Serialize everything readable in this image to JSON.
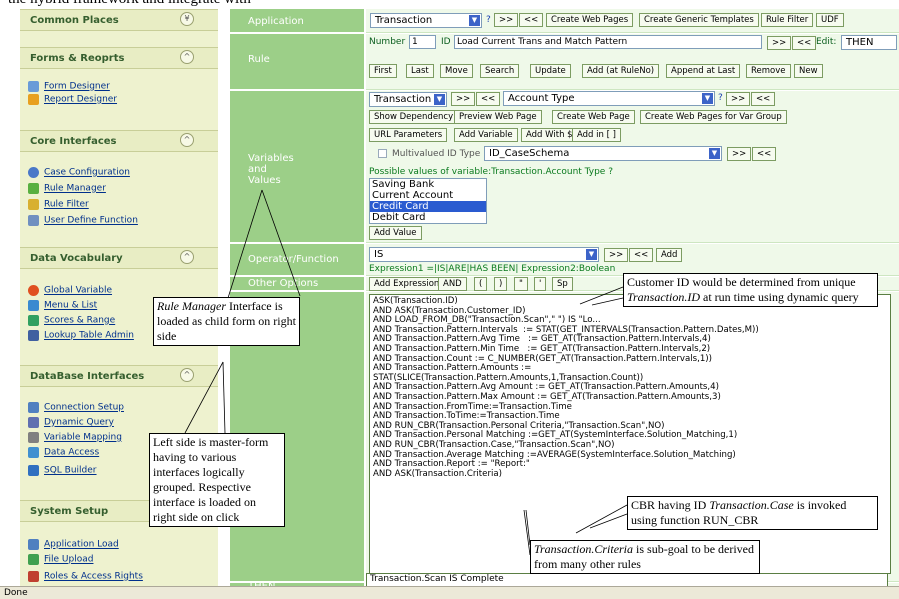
{
  "page_caption": "the hybrid framework and integrate with",
  "sidebar": {
    "sections": [
      {
        "title": "Common Places",
        "links": []
      },
      {
        "title": "Forms & Reoprts",
        "links": [
          "Form Designer",
          "Report Designer"
        ]
      },
      {
        "title": "Core Interfaces",
        "links": [
          "Case Configuration",
          "Rule Manager",
          "Rule Filter",
          "User Define Function"
        ]
      },
      {
        "title": "Data Vocabulary",
        "links": [
          "Global Variable",
          "Menu & List",
          "Scores & Range",
          "Lookup Table Admin"
        ]
      },
      {
        "title": "DataBase Interfaces",
        "links": [
          "Connection Setup",
          "Dynamic Query",
          "Variable Mapping",
          "Data Access",
          "SQL Builder"
        ]
      },
      {
        "title": "System Setup",
        "links": [
          "Application Load",
          "File Upload",
          "Roles & Access Rights"
        ]
      }
    ]
  },
  "labels": {
    "application": "Application",
    "rule": "Rule",
    "variables": "Variables\nand\nValues",
    "operator": "Operator/Function",
    "other": "Other Options",
    "if": "IF",
    "then": "THEN"
  },
  "application": {
    "select": "Transaction",
    "q": "?",
    "next": ">>",
    "prev": "<<",
    "buttons": [
      "Create Web Pages",
      "Create Generic Templates",
      "Rule Filter",
      "UDF"
    ]
  },
  "rule": {
    "number_label": "Number",
    "number": "1",
    "id_label": "ID",
    "id": "Load Current Trans and Match Pattern",
    "next": ">>",
    "prev": "<<",
    "edit_label": "Edit:",
    "edit_value": "THEN",
    "buttons": [
      "First",
      "Last",
      "Move",
      "Search",
      "Update",
      "Add (at RuleNo)",
      "Append at Last",
      "Remove",
      "New"
    ]
  },
  "variables": {
    "select1": "Transaction",
    "next": ">>",
    "prev": "<<",
    "select2": "Account Type",
    "q": "?",
    "row2": [
      "Show Dependency",
      "Preview Web Page",
      "Create Web Page",
      "Create Web Pages for Var Group"
    ],
    "row3": [
      "URL Parameters",
      "Add Variable",
      "Add With $",
      "Add in [ ]"
    ],
    "multivalued_label": "Multivalued ID Type",
    "multivalued_select": "ID_CaseSchema",
    "possible_values": "Possible values of variable:Transaction.Account Type ?",
    "list": [
      "Saving Bank",
      "Current Account",
      "Credit Card",
      "Debit Card"
    ],
    "selected": "Credit Card",
    "add_value": "Add Value"
  },
  "operator": {
    "select": "IS",
    "next": ">>",
    "prev": "<<",
    "add": "Add",
    "expression": "Expression1 =|IS|ARE|HAS BEEN| Expression2:Boolean"
  },
  "other": {
    "buttons": [
      "Add Expression",
      "AND",
      "(",
      ")",
      "\"",
      "'",
      "Sp"
    ]
  },
  "if_code": "ASK(Transaction.ID)\nAND ASK(Transaction.Customer_ID)\nAND LOAD_FROM_DB(\"Transaction.Scan\",\" \") IS \"Lo...\nAND Transaction.Pattern.Intervals  := STAT(GET_INTERVALS(Transaction.Pattern.Dates,M))\nAND Transaction.Pattern.Avg Time   := GET_AT(Transaction.Pattern.Intervals,4)\nAND Transaction.Pattern.Min Time   := GET_AT(Transaction.Pattern.Intervals,2)\nAND Transaction.Count := C_NUMBER(GET_AT(Transaction.Pattern.Intervals,1))\nAND Transaction.Pattern.Amounts :=\nSTAT(SLICE(Transaction.Pattern.Amounts,1,Transaction.Count))\nAND Transaction.Pattern.Avg Amount := GET_AT(Transaction.Pattern.Amounts,4)\nAND Transaction.Pattern.Max Amount := GET_AT(Transaction.Pattern.Amounts,3)\nAND Transaction.FromTime:=Transaction.Time\nAND Transaction.ToTime:=Transaction.Time\nAND RUN_CBR(Transaction.Personal Criteria,\"Transaction.Scan\",NO)\nAND Transaction.Personal Matching :=GET_AT(SystemInterface.Solution_Matching,1)\nAND RUN_CBR(Transaction.Case,\"Transaction.Scan\",NO)\nAND Transaction.Average Matching :=AVERAGE(SystemInterface.Solution_Matching)\nAND Transaction.Report := \"Report:\"\nAND ASK(Transaction.Criteria)",
  "then_code": "Transaction.Scan IS Complete",
  "callouts": {
    "rule_manager": {
      "em": "Rule Manager",
      "text": " Interface is loaded as child form on right side"
    },
    "left_side": "Left side is master-form having to various interfaces logically grouped. Respective interface is loaded on right side on click",
    "customer": {
      "a": "Customer ID would be determined from unique ",
      "em": "Transaction.ID",
      "b": " at run time using dynamic query"
    },
    "cbr": {
      "a": "CBR having ID ",
      "em": "Transaction.Case",
      "b": " is invoked using function RUN_CBR"
    },
    "criteria": {
      "em": "Transaction.Criteria",
      "b": " is sub-goal to be derived from many other rules"
    }
  },
  "status": "Done",
  "colors": {
    "label_green": "#9ccf88",
    "sidebar_bg": "#eef2cf",
    "section_title": "#355e2e",
    "link": "#00308c",
    "green_text": "#0a7a1e"
  }
}
